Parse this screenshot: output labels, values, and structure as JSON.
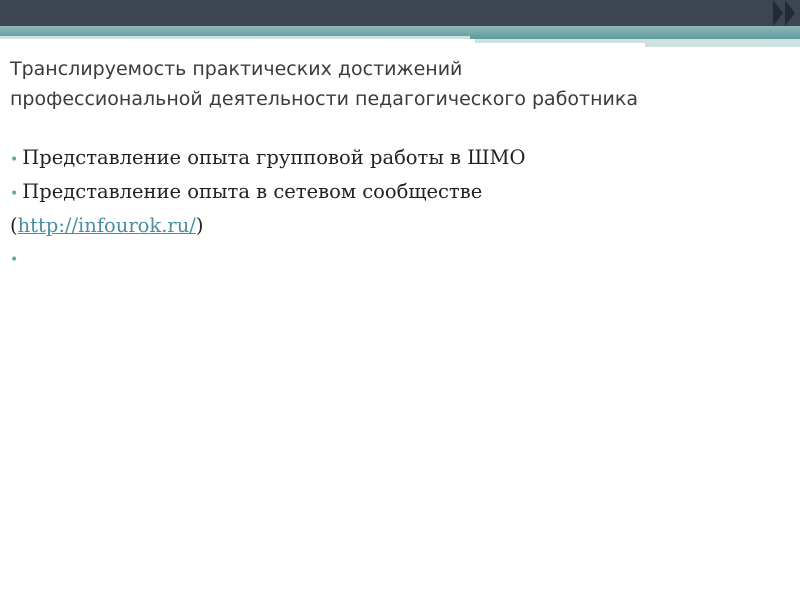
{
  "slide": {
    "title_lines": [
      "Транслируемость практических достижений",
      "профессиональной деятельности педагогического работника"
    ],
    "bullets": [
      {
        "text": "Представление опыта групповой работы в ШМО"
      },
      {
        "text": "Представление опыта в сетевом сообществе",
        "continuation_open": "(",
        "link_text": "http://infourok.ru/",
        "continuation_close": ")"
      },
      {
        "text": ""
      }
    ]
  },
  "colors": {
    "top_bar": "#3c4552",
    "teal_band": "#5e9a9c",
    "bullet": "#6aa1a3",
    "link": "#4a8ea3"
  }
}
